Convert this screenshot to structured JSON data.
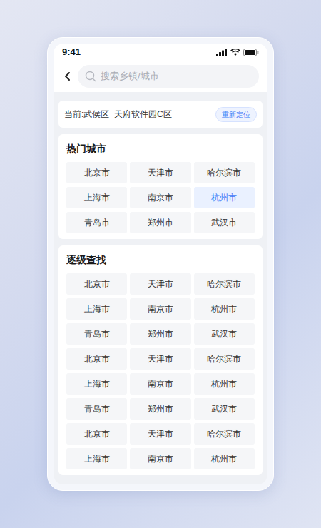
{
  "status_bar": {
    "time": "9:41"
  },
  "search": {
    "placeholder": "搜索乡镇/城市"
  },
  "location": {
    "current": "当前:武侯区  天府软件园C区",
    "button": "重新定位"
  },
  "sections": [
    {
      "title": "热门城市",
      "items": [
        {
          "label": "北京市",
          "selected": false
        },
        {
          "label": "天津市",
          "selected": false
        },
        {
          "label": "哈尔滨市",
          "selected": false
        },
        {
          "label": "上海市",
          "selected": false
        },
        {
          "label": "南京市",
          "selected": false
        },
        {
          "label": "杭州市",
          "selected": true
        },
        {
          "label": "青岛市",
          "selected": false
        },
        {
          "label": "郑州市",
          "selected": false
        },
        {
          "label": "武汉市",
          "selected": false
        }
      ]
    },
    {
      "title": "逐级查找",
      "items": [
        {
          "label": "北京市",
          "selected": false
        },
        {
          "label": "天津市",
          "selected": false
        },
        {
          "label": "哈尔滨市",
          "selected": false
        },
        {
          "label": "上海市",
          "selected": false
        },
        {
          "label": "南京市",
          "selected": false
        },
        {
          "label": "杭州市",
          "selected": false
        },
        {
          "label": "青岛市",
          "selected": false
        },
        {
          "label": "郑州市",
          "selected": false
        },
        {
          "label": "武汉市",
          "selected": false
        },
        {
          "label": "北京市",
          "selected": false
        },
        {
          "label": "天津市",
          "selected": false
        },
        {
          "label": "哈尔滨市",
          "selected": false
        },
        {
          "label": "上海市",
          "selected": false
        },
        {
          "label": "南京市",
          "selected": false
        },
        {
          "label": "杭州市",
          "selected": false
        },
        {
          "label": "青岛市",
          "selected": false
        },
        {
          "label": "郑州市",
          "selected": false
        },
        {
          "label": "武汉市",
          "selected": false
        },
        {
          "label": "北京市",
          "selected": false
        },
        {
          "label": "天津市",
          "selected": false
        },
        {
          "label": "哈尔滨市",
          "selected": false
        },
        {
          "label": "上海市",
          "selected": false
        },
        {
          "label": "南京市",
          "selected": false
        },
        {
          "label": "杭州市",
          "selected": false
        }
      ]
    }
  ]
}
